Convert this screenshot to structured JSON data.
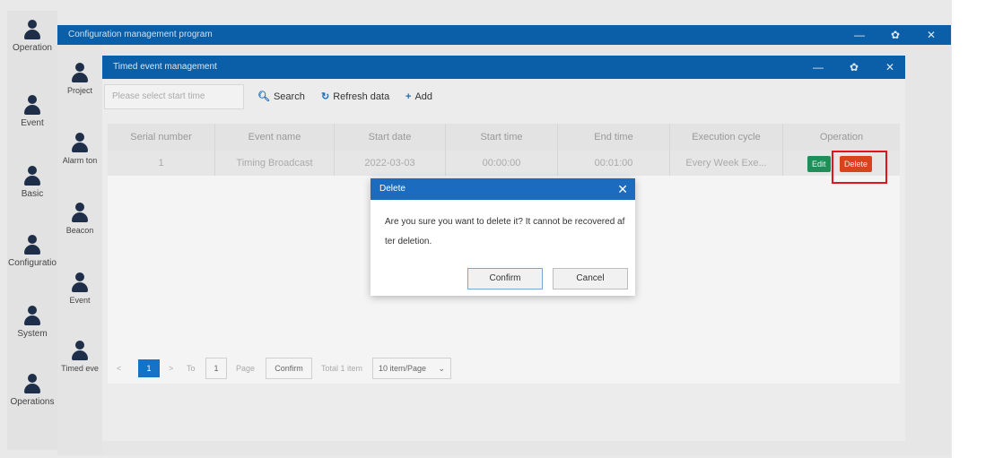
{
  "left_nav": [
    {
      "label": "Operation"
    },
    {
      "label": "Event"
    },
    {
      "label": "Basic"
    },
    {
      "label": "Configuratio"
    },
    {
      "label": "System"
    },
    {
      "label": "Operations"
    }
  ],
  "outer_window": {
    "title": "Configuration management program",
    "minimize": "—",
    "restore": "✿",
    "close": "✕"
  },
  "sub_nav": [
    {
      "label": "Project"
    },
    {
      "label": "Alarm ton"
    },
    {
      "label": "Beacon"
    },
    {
      "label": "Event"
    },
    {
      "label": "Timed eve"
    }
  ],
  "inner_window": {
    "title": "Timed event management",
    "minimize": "—",
    "restore": "✿",
    "close": "✕"
  },
  "toolbar": {
    "start_time_placeholder": "Please select start time",
    "search_icon": "search-icon",
    "search_label": "Search",
    "refresh_icon": "refresh-icon",
    "refresh_label": "Refresh data",
    "add_icon": "plus-icon",
    "add_label": "Add"
  },
  "table": {
    "headers": [
      "Serial number",
      "Event name",
      "Start date",
      "Start time",
      "End time",
      "Execution cycle",
      "Operation"
    ],
    "rows": [
      {
        "serial": "1",
        "event_name": "Timing Broadcast",
        "start_date": "2022-03-03",
        "start_time": "00:00:00",
        "end_time": "00:01:00",
        "execution_cycle": "Every Week Exe...",
        "edit_label": "Edit",
        "delete_label": "Delete"
      }
    ]
  },
  "pagination": {
    "prev": "<",
    "current_page": "1",
    "next": ">",
    "to_label": "To",
    "page_input": "1",
    "page_label": "Page",
    "confirm_label": "Confirm",
    "total_label": "Total 1 item",
    "page_size": "10 item/Page"
  },
  "modal": {
    "title": "Delete",
    "close": "✕",
    "message": "Are you sure you want to delete it? It cannot be recovered after deletion.",
    "confirm_label": "Confirm",
    "cancel_label": "Cancel"
  },
  "colors": {
    "title_bar": "#0a5fa8",
    "modal_title": "#1b6bbf",
    "edit_button": "#1e8f5a",
    "delete_button": "#d9431c",
    "highlight": "#e2131b"
  }
}
